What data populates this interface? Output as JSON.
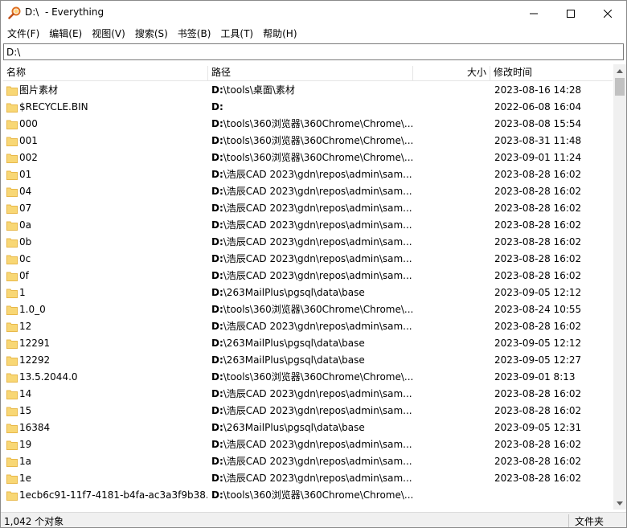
{
  "window": {
    "title": "D:\\  - Everything",
    "minimize_icon": "minimize-icon",
    "maximize_icon": "maximize-icon",
    "close_icon": "close-icon"
  },
  "menu": [
    "文件(F)",
    "编辑(E)",
    "视图(V)",
    "搜索(S)",
    "书签(B)",
    "工具(T)",
    "帮助(H)"
  ],
  "search": {
    "value": "D:\\"
  },
  "columns": {
    "name": "名称",
    "path": "路径",
    "size": "大小",
    "modified": "修改时间"
  },
  "rows": [
    {
      "name": "图片素材",
      "drive": "D:",
      "path": "\\tools\\桌面\\素材",
      "modified": "2023-08-16 14:28"
    },
    {
      "name": "$RECYCLE.BIN",
      "drive": "D:",
      "path": "",
      "modified": "2022-06-08 16:04"
    },
    {
      "name": "000",
      "drive": "D:",
      "path": "\\tools\\360浏览器\\360Chrome\\Chrome\\...",
      "modified": "2023-08-08 15:54"
    },
    {
      "name": "001",
      "drive": "D:",
      "path": "\\tools\\360浏览器\\360Chrome\\Chrome\\...",
      "modified": "2023-08-31 11:48"
    },
    {
      "name": "002",
      "drive": "D:",
      "path": "\\tools\\360浏览器\\360Chrome\\Chrome\\...",
      "modified": "2023-09-01 11:24"
    },
    {
      "name": "01",
      "drive": "D:",
      "path": "\\浩辰CAD 2023\\gdn\\repos\\admin\\sam...",
      "modified": "2023-08-28 16:02"
    },
    {
      "name": "04",
      "drive": "D:",
      "path": "\\浩辰CAD 2023\\gdn\\repos\\admin\\sam...",
      "modified": "2023-08-28 16:02"
    },
    {
      "name": "07",
      "drive": "D:",
      "path": "\\浩辰CAD 2023\\gdn\\repos\\admin\\sam...",
      "modified": "2023-08-28 16:02"
    },
    {
      "name": "0a",
      "drive": "D:",
      "path": "\\浩辰CAD 2023\\gdn\\repos\\admin\\sam...",
      "modified": "2023-08-28 16:02"
    },
    {
      "name": "0b",
      "drive": "D:",
      "path": "\\浩辰CAD 2023\\gdn\\repos\\admin\\sam...",
      "modified": "2023-08-28 16:02"
    },
    {
      "name": "0c",
      "drive": "D:",
      "path": "\\浩辰CAD 2023\\gdn\\repos\\admin\\sam...",
      "modified": "2023-08-28 16:02"
    },
    {
      "name": "0f",
      "drive": "D:",
      "path": "\\浩辰CAD 2023\\gdn\\repos\\admin\\sam...",
      "modified": "2023-08-28 16:02"
    },
    {
      "name": "1",
      "drive": "D:",
      "path": "\\263MailPlus\\pgsql\\data\\base",
      "modified": "2023-09-05 12:12"
    },
    {
      "name": "1.0_0",
      "drive": "D:",
      "path": "\\tools\\360浏览器\\360Chrome\\Chrome\\...",
      "modified": "2023-08-24 10:55"
    },
    {
      "name": "12",
      "drive": "D:",
      "path": "\\浩辰CAD 2023\\gdn\\repos\\admin\\sam...",
      "modified": "2023-08-28 16:02"
    },
    {
      "name": "12291",
      "drive": "D:",
      "path": "\\263MailPlus\\pgsql\\data\\base",
      "modified": "2023-09-05 12:12"
    },
    {
      "name": "12292",
      "drive": "D:",
      "path": "\\263MailPlus\\pgsql\\data\\base",
      "modified": "2023-09-05 12:27"
    },
    {
      "name": "13.5.2044.0",
      "drive": "D:",
      "path": "\\tools\\360浏览器\\360Chrome\\Chrome\\...",
      "modified": "2023-09-01 8:13"
    },
    {
      "name": "14",
      "drive": "D:",
      "path": "\\浩辰CAD 2023\\gdn\\repos\\admin\\sam...",
      "modified": "2023-08-28 16:02"
    },
    {
      "name": "15",
      "drive": "D:",
      "path": "\\浩辰CAD 2023\\gdn\\repos\\admin\\sam...",
      "modified": "2023-08-28 16:02"
    },
    {
      "name": "16384",
      "drive": "D:",
      "path": "\\263MailPlus\\pgsql\\data\\base",
      "modified": "2023-09-05 12:31"
    },
    {
      "name": "19",
      "drive": "D:",
      "path": "\\浩辰CAD 2023\\gdn\\repos\\admin\\sam...",
      "modified": "2023-08-28 16:02"
    },
    {
      "name": "1a",
      "drive": "D:",
      "path": "\\浩辰CAD 2023\\gdn\\repos\\admin\\sam...",
      "modified": "2023-08-28 16:02"
    },
    {
      "name": "1e",
      "drive": "D:",
      "path": "\\浩辰CAD 2023\\gdn\\repos\\admin\\sam...",
      "modified": "2023-08-28 16:02"
    },
    {
      "name": "1ecb6c91-11f7-4181-b4fa-ac3a3f9b38...",
      "drive": "D:",
      "path": "\\tools\\360浏览器\\360Chrome\\Chrome\\...",
      "modified": ""
    }
  ],
  "status": {
    "count": "1,042 个对象",
    "type": "文件夹"
  },
  "colors": {
    "folder": "#f8d775",
    "folder_dark": "#e8b84a",
    "scrollbar_thumb": "#c1c1c1"
  }
}
